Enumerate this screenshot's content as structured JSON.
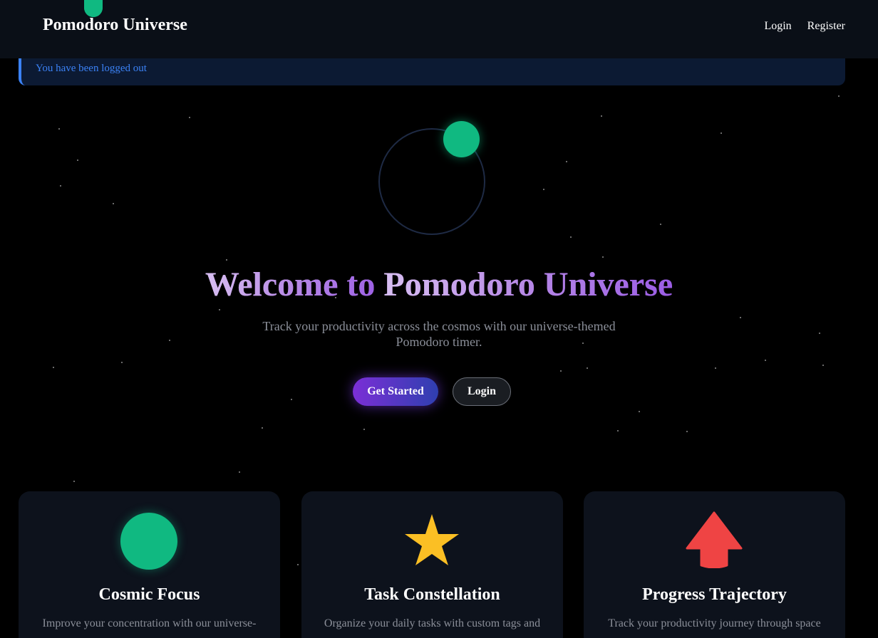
{
  "app": {
    "brand": "Pomodoro Universe"
  },
  "nav": {
    "login": "Login",
    "register": "Register"
  },
  "flash": {
    "message": "You have been logged out"
  },
  "hero": {
    "title_part1": "Welcome to ",
    "title_part2": "Pomodoro Universe",
    "subtitle": "Track your productivity across the cosmos with our universe-themed Pomodoro timer.",
    "get_started": "Get Started",
    "login": "Login"
  },
  "features": [
    {
      "icon": "green-planet-icon",
      "title": "Cosmic Focus",
      "text": "Improve your concentration with our universe-"
    },
    {
      "icon": "star-icon",
      "title": "Task Constellation",
      "text": "Organize your daily tasks with custom tags and"
    },
    {
      "icon": "arrow-up-icon",
      "title": "Progress Trajectory",
      "text": "Track your productivity journey through space"
    }
  ],
  "colors": {
    "accent_green": "#10b981",
    "accent_purple": "#7b2fd6",
    "star_yellow": "#fbbf24",
    "arrow_red": "#ef4444",
    "flash_blue": "#3b82f6"
  }
}
